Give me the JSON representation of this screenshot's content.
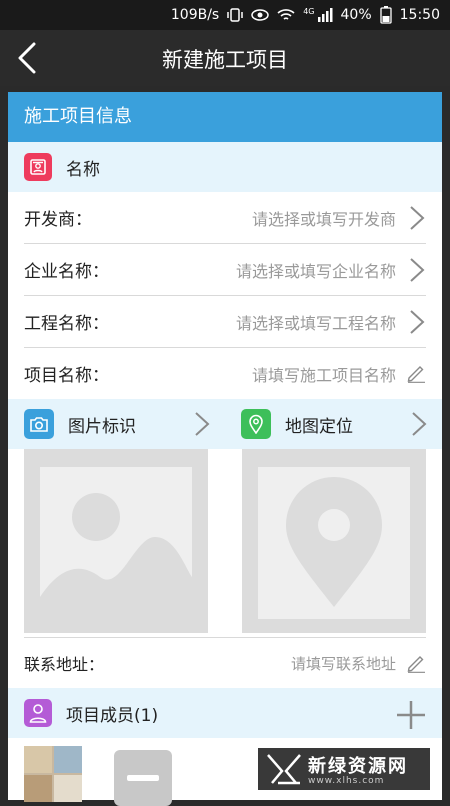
{
  "status_bar": {
    "speed": "109B/s",
    "network": "4G",
    "battery": "40%",
    "time": "15:50"
  },
  "header": {
    "title": "新建施工项目"
  },
  "form": {
    "section_title": "施工项目信息",
    "name_section_label": "名称",
    "rows": [
      {
        "label": "开发商：",
        "placeholder": "请选择或填写开发商"
      },
      {
        "label": "企业名称：",
        "placeholder": "请选择或填写企业名称"
      },
      {
        "label": "工程名称：",
        "placeholder": "请选择或填写工程名称"
      },
      {
        "label": "项目名称：",
        "placeholder": "请填写施工项目名称"
      }
    ],
    "image_section_label": "图片标识",
    "map_section_label": "地图定位",
    "address": {
      "label": "联系地址：",
      "placeholder": "请填写联系地址"
    },
    "members_section_label": "项目成员(1)"
  },
  "watermark": {
    "name": "新绿资源网",
    "url": "www.xlhs.com"
  },
  "colors": {
    "accent": "#3aa0dc",
    "section_bg": "#e5f4fc",
    "name_icon": "#ee3b5d",
    "camera_icon": "#3aa0dc",
    "map_icon": "#3dbf5a",
    "member_icon": "#b45bd6"
  }
}
